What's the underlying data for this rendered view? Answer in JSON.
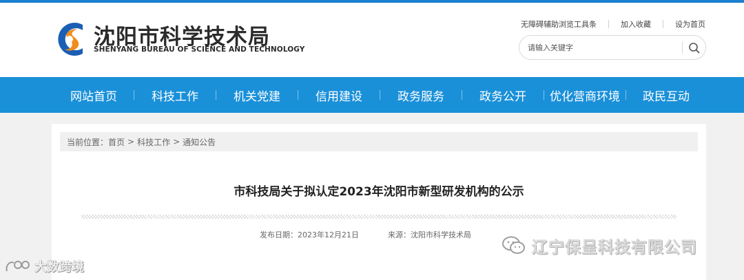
{
  "header": {
    "logo": {
      "cn": "沈阳市科学技术局",
      "en": "SHENYANG BUREAU OF SCIENCE AND TECHNOLOGY",
      "icon": "bureau-logo-icon"
    },
    "toplinks": [
      "无障碍辅助浏览工具条",
      "加入收藏",
      "设为首页"
    ],
    "search": {
      "placeholder": "请输入关键字",
      "icon": "search-icon"
    }
  },
  "nav": {
    "items": [
      "网站首页",
      "科技工作",
      "机关党建",
      "信用建设",
      "政务服务",
      "政务公开",
      "优化营商环境",
      "政民互动"
    ]
  },
  "breadcrumb": {
    "label": "当前位置：",
    "items": [
      "首页",
      "科技工作",
      "通知公告"
    ],
    "separator": ">"
  },
  "article": {
    "title": "市科技局关于拟认定2023年沈阳市新型研发机构的公示",
    "publish_label": "发布日期：",
    "publish_date": "2023年12月21日",
    "source_label": "来源：",
    "source": "沈阳市科学技术局"
  },
  "watermarks": {
    "right": "辽宁保呈科技有限公司",
    "left": "大数跨境"
  },
  "colors": {
    "nav_bg": "#1a90d9",
    "top_line": "#1a7fd0",
    "page_bg": "#f1f1f1",
    "logo_blue": "#1a5fb4",
    "logo_orange": "#f08c1e"
  }
}
